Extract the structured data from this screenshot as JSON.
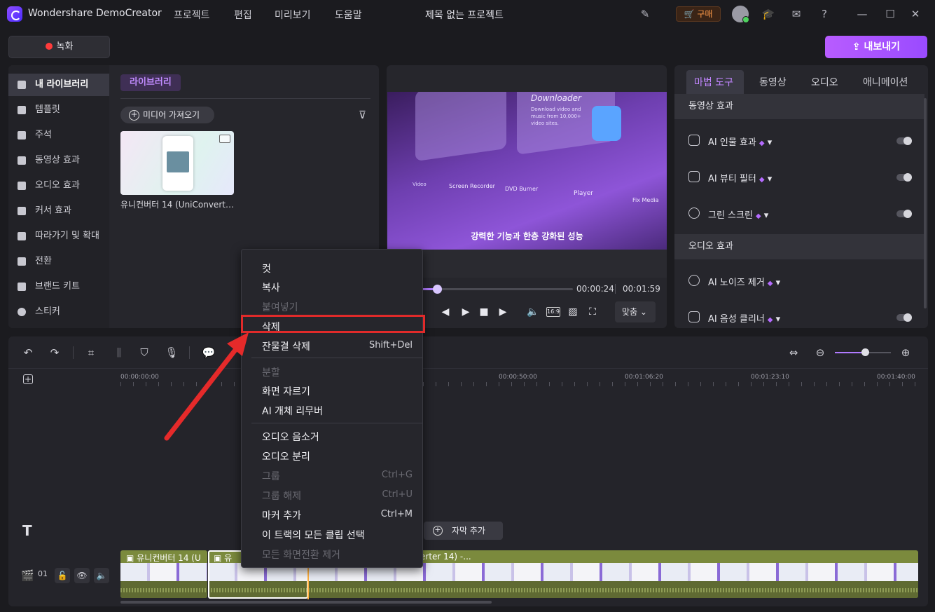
{
  "app": {
    "title": "Wondershare DemoCreator",
    "project_title": "제목 없는 프로젝트"
  },
  "menu": [
    "프로젝트",
    "편집",
    "미리보기",
    "도움말"
  ],
  "topbar": {
    "buy_label": "구매",
    "record_label": "녹화",
    "export_label": "내보내기"
  },
  "sidebar": {
    "items": [
      {
        "label": "내 라이브러리",
        "icon": "layers-icon",
        "active": true
      },
      {
        "label": "템플릿",
        "icon": "template-icon"
      },
      {
        "label": "주석",
        "icon": "annotation-icon"
      },
      {
        "label": "동영상 효과",
        "icon": "video-effect-icon"
      },
      {
        "label": "오디오 효과",
        "icon": "audio-effect-icon"
      },
      {
        "label": "커서 효과",
        "icon": "cursor-effect-icon"
      },
      {
        "label": "따라가기 및 확대",
        "icon": "zoom-follow-icon"
      },
      {
        "label": "전환",
        "icon": "transition-icon"
      },
      {
        "label": "브랜드 키트",
        "icon": "brand-kit-icon"
      },
      {
        "label": "스티커",
        "icon": "sticker-icon"
      }
    ]
  },
  "library": {
    "tab_label": "라이브러리",
    "import_label": "미디어 가져오기",
    "media_name": "유니컨버터 14 (UniConverter 14) -...",
    "filter_icon": "filter-icon"
  },
  "preview": {
    "caption": "강력한 기능과 한층 강화된 성능",
    "card_texts": [
      "Downloader",
      "Download video and music from 10,000+ video sites.",
      "Video",
      "Screen Recorder",
      "DVD Burner",
      "Player",
      "Fix Media"
    ],
    "time_current": "00:00:24",
    "time_total": "00:01:59",
    "progress": 0.2,
    "aspect_label": "16:9",
    "fit_label": "맞춤"
  },
  "right_panel": {
    "tabs": [
      "마법 도구",
      "동영상",
      "오디오",
      "애니메이션"
    ],
    "active_tab": 0,
    "video_section": "동영상 효과",
    "video_effects": [
      {
        "label": "AI 인물 효과",
        "enabled": false
      },
      {
        "label": "AI 뷰티 필터",
        "enabled": false
      },
      {
        "label": "그린 스크린",
        "enabled": false
      }
    ],
    "audio_section": "오디오 효과",
    "audio_effects": [
      {
        "label": "AI 노이즈 제거"
      },
      {
        "label": "AI 음성 클리너",
        "enabled": false
      }
    ],
    "accent": "#c185ff"
  },
  "timeline": {
    "ruler": [
      "00:00:00:00",
      "00:00:50:00",
      "00:01:06:20",
      "00:01:23:10",
      "00:01:40:00"
    ],
    "subtitle_add_label": "자막 추가",
    "track_number": "01",
    "clips": [
      {
        "label": "유니컨버터 14 (U"
      },
      {
        "label": "유"
      },
      {
        "label": "erter 14) -..."
      }
    ],
    "zoom": 0.55
  },
  "context_menu": {
    "items": [
      {
        "label": "컷",
        "shortcut": "",
        "disabled": false
      },
      {
        "label": "복사",
        "shortcut": "",
        "disabled": false
      },
      {
        "label": "붙여넣기",
        "shortcut": "",
        "disabled": true
      },
      {
        "label": "삭제",
        "shortcut": "",
        "disabled": false,
        "highlighted": true
      },
      {
        "label": "잔물결 삭제",
        "shortcut": "Shift+Del",
        "disabled": false
      },
      {
        "label": "분할",
        "shortcut": "",
        "disabled": true
      },
      {
        "label": "화면 자르기",
        "shortcut": "",
        "disabled": false
      },
      {
        "label": "AI 개체 리무버",
        "shortcut": "",
        "disabled": false
      },
      {
        "label": "오디오 음소거",
        "shortcut": "",
        "disabled": false
      },
      {
        "label": "오디오 분리",
        "shortcut": "",
        "disabled": false
      },
      {
        "label": "그룹",
        "shortcut": "Ctrl+G",
        "disabled": true
      },
      {
        "label": "그룹 해제",
        "shortcut": "Ctrl+U",
        "disabled": true
      },
      {
        "label": "마커 추가",
        "shortcut": "Ctrl+M",
        "disabled": false
      },
      {
        "label": "이 트랙의 모든 클립 선택",
        "shortcut": "",
        "disabled": false
      },
      {
        "label": "모든 화면전환 제거",
        "shortcut": "",
        "disabled": true
      }
    ],
    "highlight_color": "#e02a2a"
  }
}
